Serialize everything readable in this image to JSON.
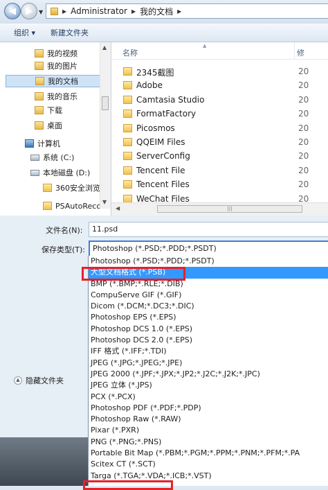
{
  "address": {
    "crumbs": [
      "Administrator",
      "我的文档"
    ]
  },
  "toolbar": {
    "organize": "组织 ▾",
    "new_folder": "新建文件夹"
  },
  "nav": {
    "items": [
      {
        "label": "我的视频",
        "icon": "library-icon"
      },
      {
        "label": "我的图片",
        "icon": "library-icon"
      },
      {
        "label": "我的文档",
        "icon": "library-icon",
        "selected": true
      },
      {
        "label": "我的音乐",
        "icon": "library-icon"
      },
      {
        "label": "下载",
        "icon": "library-icon"
      },
      {
        "label": "桌面",
        "icon": "library-icon"
      },
      {
        "label": "计算机",
        "icon": "computer-icon"
      },
      {
        "label": "系统 (C:)",
        "icon": "drive-icon"
      },
      {
        "label": "本地磁盘 (D:)",
        "icon": "drive-icon"
      },
      {
        "label": "360安全浏览",
        "icon": "folder-icon"
      },
      {
        "label": "PSAutoReco",
        "icon": "folder-icon"
      }
    ]
  },
  "files": {
    "col_name": "名称",
    "col_modified": "修",
    "rows": [
      {
        "name": "2345截图",
        "date": "20"
      },
      {
        "name": "Adobe",
        "date": "20"
      },
      {
        "name": "Camtasia Studio",
        "date": "20"
      },
      {
        "name": "FormatFactory",
        "date": "20"
      },
      {
        "name": "Picosmos",
        "date": "20"
      },
      {
        "name": "QQEIM Files",
        "date": "20"
      },
      {
        "name": "ServerConfig",
        "date": "20"
      },
      {
        "name": "Tencent File",
        "date": "20"
      },
      {
        "name": "Tencent Files",
        "date": "20"
      },
      {
        "name": "WeChat Files",
        "date": "20"
      }
    ]
  },
  "form": {
    "filename_label": "文件名(N):",
    "filename_value": "11.psd",
    "type_label": "保存类型(T):",
    "type_value": "Photoshop (*.PSD;*.PDD;*.PSDT)",
    "hide_folders": "隐藏文件夹"
  },
  "dropdown": {
    "options": [
      "Photoshop (*.PSD;*.PDD;*.PSDT)",
      "大型文档格式 (*.PSB)",
      "BMP (*.BMP;*.RLE;*.DIB)",
      "CompuServe GIF (*.GIF)",
      "Dicom (*.DCM;*.DC3;*.DIC)",
      "Photoshop EPS (*.EPS)",
      "Photoshop DCS 1.0 (*.EPS)",
      "Photoshop DCS 2.0 (*.EPS)",
      "IFF 格式 (*.IFF;*.TDI)",
      "JPEG (*.JPG;*.JPEG;*.JPE)",
      "JPEG 2000 (*.JPF;*.JPX;*.JP2;*.J2C;*.J2K;*.JPC)",
      "JPEG 立体 (*.JPS)",
      "PCX (*.PCX)",
      "Photoshop PDF (*.PDF;*.PDP)",
      "Photoshop Raw (*.RAW)",
      "Pixar (*.PXR)",
      "PNG (*.PNG;*.PNS)",
      "Portable Bit Map (*.PBM;*.PGM;*.PPM;*.PNM;*.PFM;*.PA",
      "Scitex CT (*.SCT)",
      "Targa (*.TGA;*.VDA;*.ICB;*.VST)"
    ],
    "selected_index": 1
  },
  "colors": {
    "selection": "#3399ff",
    "highlight_box": "#e8202a"
  }
}
